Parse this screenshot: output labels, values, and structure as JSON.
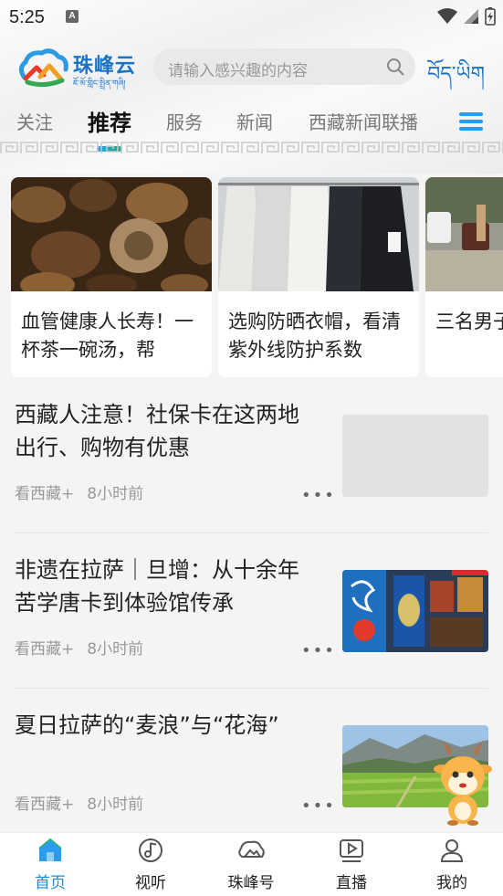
{
  "status": {
    "time": "5:25",
    "notif": "A"
  },
  "header": {
    "logo_text": "珠峰云",
    "logo_sub": "ཇོ་མོ་གླིང་སྤྲིན་གཞི།",
    "search_placeholder": "请输入感兴趣的内容",
    "tibetan_btn": "བོད་ཡིག"
  },
  "tabs": [
    {
      "label": "关注"
    },
    {
      "label": "推荐"
    },
    {
      "label": "服务"
    },
    {
      "label": "新闻"
    },
    {
      "label": "西藏新闻联播"
    }
  ],
  "cards": [
    {
      "title": "血管健康人长寿！一杯茶一碗汤，帮"
    },
    {
      "title": "选购防晒衣帽，看清紫外线防护系数"
    },
    {
      "title": "三名男子车数百米"
    }
  ],
  "news": [
    {
      "title": "西藏人注意！社保卡在这两地出行、购物有优惠",
      "source": "看西藏+",
      "time": "8小时前",
      "more": "•••"
    },
    {
      "title": "非遗在拉萨｜旦增：从十余年苦学唐卡到体验馆传承",
      "source": "看西藏+",
      "time": "8小时前",
      "more": "•••"
    },
    {
      "title": "夏日拉萨的“麦浪”与“花海”",
      "source": "看西藏+",
      "time": "8小时前",
      "more": "•••"
    }
  ],
  "nav": [
    {
      "label": "首页"
    },
    {
      "label": "视听"
    },
    {
      "label": "珠峰号"
    },
    {
      "label": "直播"
    },
    {
      "label": "我的"
    }
  ],
  "colors": {
    "accent": "#1d8ed8",
    "brand": "#1b73c8"
  }
}
